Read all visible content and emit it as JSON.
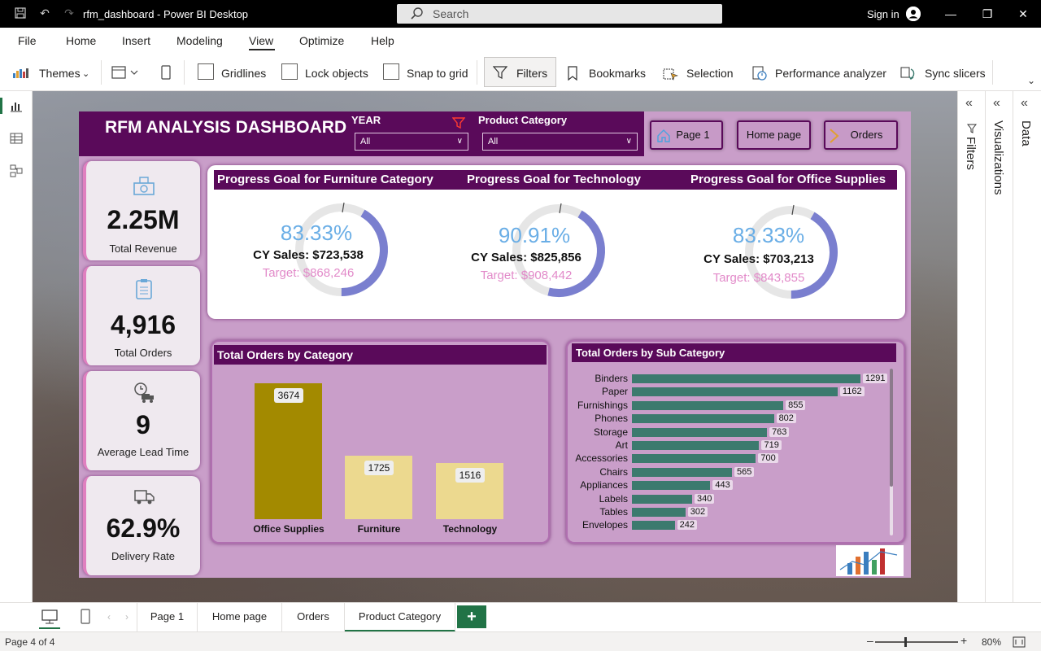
{
  "window": {
    "title": "rfm_dashboard - Power BI Desktop",
    "search_placeholder": "Search",
    "signin": "Sign in"
  },
  "menu": {
    "items": [
      "File",
      "Home",
      "Insert",
      "Modeling",
      "View",
      "Optimize",
      "Help"
    ],
    "active": "View"
  },
  "ribbon": {
    "themes": "Themes",
    "gridlines": "Gridlines",
    "lock_objects": "Lock objects",
    "snap_to_grid": "Snap to grid",
    "filters": "Filters",
    "bookmarks": "Bookmarks",
    "selection": "Selection",
    "performance_analyzer": "Performance analyzer",
    "sync_slicers": "Sync slicers"
  },
  "panes": {
    "filters": "Filters",
    "visualizations": "Visualizations",
    "data": "Data"
  },
  "report": {
    "title": "RFM ANALYSIS DASHBOARD",
    "slicers": {
      "year_label": "YEAR",
      "year_value": "All",
      "category_label": "Product Category",
      "category_value": "All"
    },
    "nav_buttons": [
      "Page 1",
      "Home page",
      "Orders"
    ],
    "kpis": [
      {
        "value": "2.25M",
        "label": "Total Revenue"
      },
      {
        "value": "4,916",
        "label": "Total Orders"
      },
      {
        "value": "9",
        "label": "Average Lead Time"
      },
      {
        "value": "62.9%",
        "label": "Delivery Rate"
      }
    ],
    "gauges": [
      {
        "title": "Progress Goal for Furniture Category",
        "pct": "83.33%",
        "cy": "CY Sales: $723,538",
        "target": "Target: $868,246",
        "fraction": 0.8333
      },
      {
        "title": "Progress Goal for Technology",
        "pct": "90.91%",
        "cy": "CY Sales: $825,856",
        "target": "Target: $908,442",
        "fraction": 0.9091
      },
      {
        "title": "Progress Goal for Office Supplies",
        "pct": "83.33%",
        "cy": "CY Sales: $703,213",
        "target": "Target: $843,855",
        "fraction": 0.8333
      }
    ],
    "colors": {
      "header": "#5a0a5a",
      "panel": "#c99ec9",
      "gauge_fill": "#7a7fcf",
      "gauge_pct": "#6aaee6",
      "target": "#e28ac9",
      "bar_dark": "#a38a00",
      "bar_light": "#ecd98f",
      "subbar": "#3c7a6e"
    }
  },
  "chart_data": [
    {
      "type": "bar",
      "title": "Total Orders by Category",
      "categories": [
        "Office Supplies",
        "Furniture",
        "Technology"
      ],
      "values": [
        3674,
        1725,
        1516
      ],
      "ylim": [
        0,
        3674
      ]
    },
    {
      "type": "bar",
      "orientation": "horizontal",
      "title": "Total Orders by Sub Category",
      "categories": [
        "Binders",
        "Paper",
        "Furnishings",
        "Phones",
        "Storage",
        "Art",
        "Accessories",
        "Chairs",
        "Appliances",
        "Labels",
        "Tables",
        "Envelopes"
      ],
      "values": [
        1291,
        1162,
        855,
        802,
        763,
        719,
        700,
        565,
        443,
        340,
        302,
        242
      ],
      "xlim": [
        0,
        1291
      ]
    }
  ],
  "tabs": {
    "items": [
      "Page 1",
      "Home page",
      "Orders",
      "Product Category"
    ],
    "active": "Product Category",
    "add": "+"
  },
  "status": {
    "page": "Page 4 of 4",
    "zoom": "80%"
  }
}
